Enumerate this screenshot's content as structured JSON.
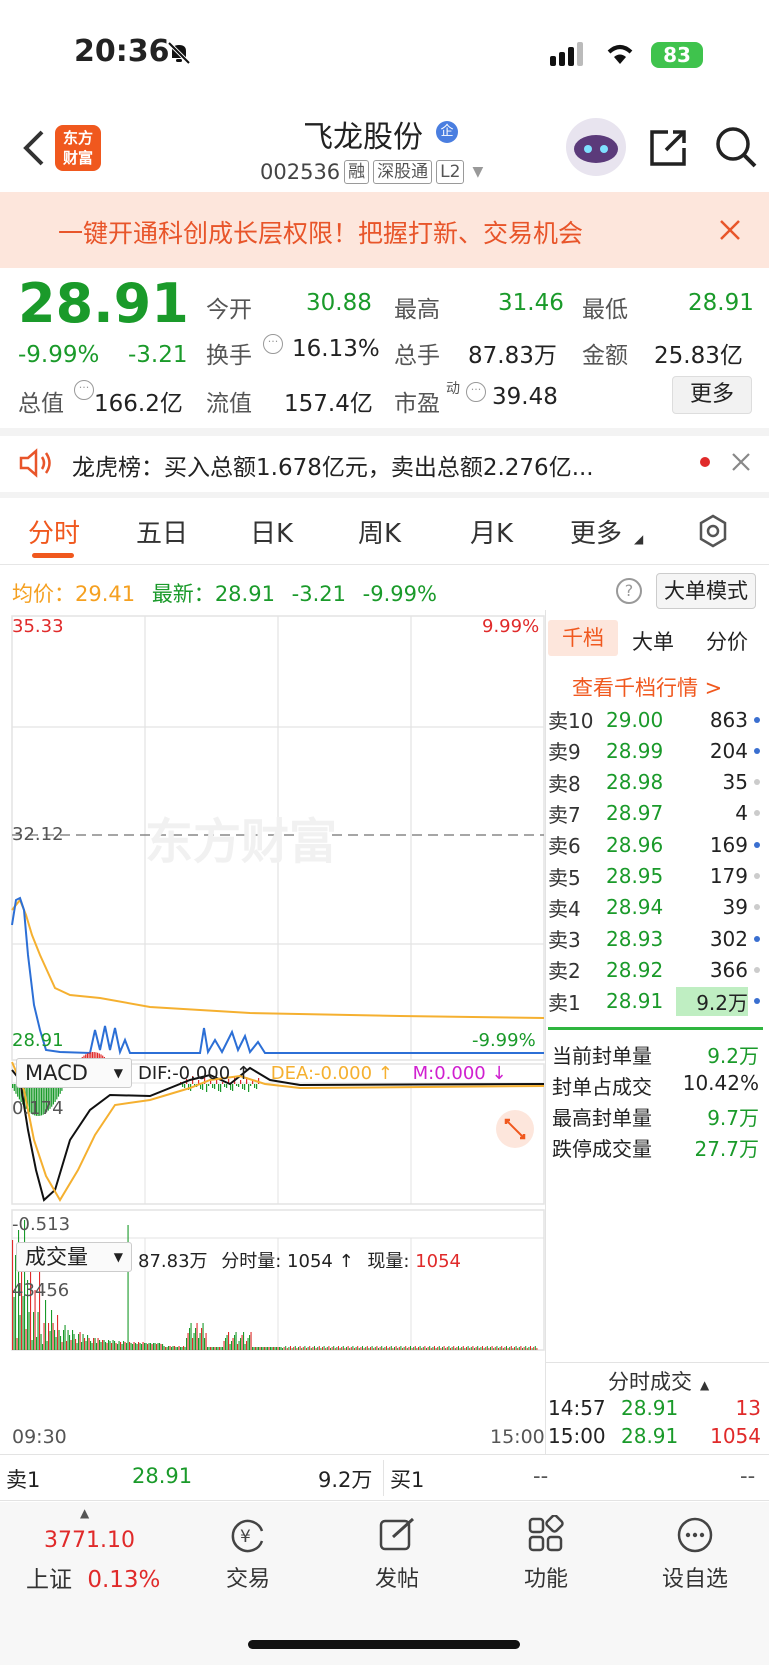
{
  "status_bar": {
    "time": "20:36",
    "battery": "83"
  },
  "header": {
    "title": "飞龙股份",
    "title_badge": "企",
    "code": "002536",
    "tags": [
      "融",
      "深股通",
      "L2"
    ],
    "logo_text": [
      "东方",
      "财富"
    ]
  },
  "banner": {
    "text": "一键开通科创成长层权限！把握打新、交易机会"
  },
  "quote": {
    "price": "28.91",
    "change_pct": "-9.99%",
    "change": "-3.21",
    "open_label": "今开",
    "open": "30.88",
    "high_label": "最高",
    "high": "31.46",
    "low_label": "最低",
    "low": "28.91",
    "turnover_label": "换手",
    "turnover": "16.13%",
    "volume_label": "总手",
    "volume": "87.83万",
    "amount_label": "金额",
    "amount": "25.83亿",
    "mktcap_label": "总值",
    "mktcap": "166.2亿",
    "float_label": "流值",
    "float": "157.4亿",
    "pe_label": "市盈",
    "pe_sup": "动",
    "pe": "39.48",
    "more_label": "更多"
  },
  "notice": {
    "text": "龙虎榜：买入总额1.678亿元，卖出总额2.276亿..."
  },
  "tabs": [
    "分时",
    "五日",
    "日K",
    "周K",
    "月K",
    "更多"
  ],
  "avg_line": {
    "avg_label": "均价：",
    "avg": "29.41",
    "latest_label": "最新：",
    "latest": "28.91",
    "change": "-3.21",
    "pct": "-9.99%",
    "mode_label": "大单模式"
  },
  "chart_labels": {
    "top_price": "35.33",
    "top_pct": "9.99%",
    "mid_price": "32.12",
    "bottom_price": "28.91",
    "bottom_pct": "-9.99%",
    "watermark": "东方财富"
  },
  "macd": {
    "name": "MACD",
    "dif": "DIF:-0.000 ↑",
    "dea": "DEA:-0.000 ↑",
    "m": "M:0.000 ↓",
    "top": "0.174",
    "bottom": "-0.513"
  },
  "volume_panel": {
    "name": "成交量",
    "total": "87.83万",
    "tick_label": "分时量: 1054 ↑",
    "now_label": "现量: ",
    "now": "1054",
    "top": "43456",
    "start_time": "09:30",
    "end_time": "15:00"
  },
  "book": {
    "tabs": [
      "千档",
      "大单",
      "分价"
    ],
    "link": "查看千档行情 >",
    "asks": [
      {
        "label": "卖10",
        "price": "29.00",
        "vol": "863"
      },
      {
        "label": "卖9",
        "price": "28.99",
        "vol": "204"
      },
      {
        "label": "卖8",
        "price": "28.98",
        "vol": "35"
      },
      {
        "label": "卖7",
        "price": "28.97",
        "vol": "4"
      },
      {
        "label": "卖6",
        "price": "28.96",
        "vol": "169"
      },
      {
        "label": "卖5",
        "price": "28.95",
        "vol": "179"
      },
      {
        "label": "卖4",
        "price": "28.94",
        "vol": "39"
      },
      {
        "label": "卖3",
        "price": "28.93",
        "vol": "302"
      },
      {
        "label": "卖2",
        "price": "28.92",
        "vol": "366"
      },
      {
        "label": "卖1",
        "price": "28.91",
        "vol": "9.2万"
      }
    ],
    "seal": [
      {
        "label": "当前封单量",
        "value": "9.2万"
      },
      {
        "label": "封单占成交",
        "value": "10.42%"
      },
      {
        "label": "最高封单量",
        "value": "9.7万"
      },
      {
        "label": "跌停成交量",
        "value": "27.7万"
      }
    ],
    "ticks_title": "分时成交",
    "ticks": [
      {
        "time": "14:57",
        "price": "28.91",
        "vol": "13"
      },
      {
        "time": "15:00",
        "price": "28.91",
        "vol": "1054"
      }
    ]
  },
  "bottom_book": {
    "sell_label": "卖1",
    "sell_price": "28.91",
    "sell_vol": "9.2万",
    "buy_label": "买1",
    "buy_price": "--",
    "buy_vol": "--"
  },
  "bottom_nav": {
    "index_value": "3771.10",
    "index_name": "上证",
    "index_pct": "0.13%",
    "items": [
      "交易",
      "发帖",
      "功能",
      "设自选"
    ]
  },
  "colors": {
    "up": "#e02a2a",
    "down": "#1a9a2a",
    "accent": "#f0581e",
    "avg_line": "#f5b030",
    "price_line": "#2c6fd6"
  }
}
